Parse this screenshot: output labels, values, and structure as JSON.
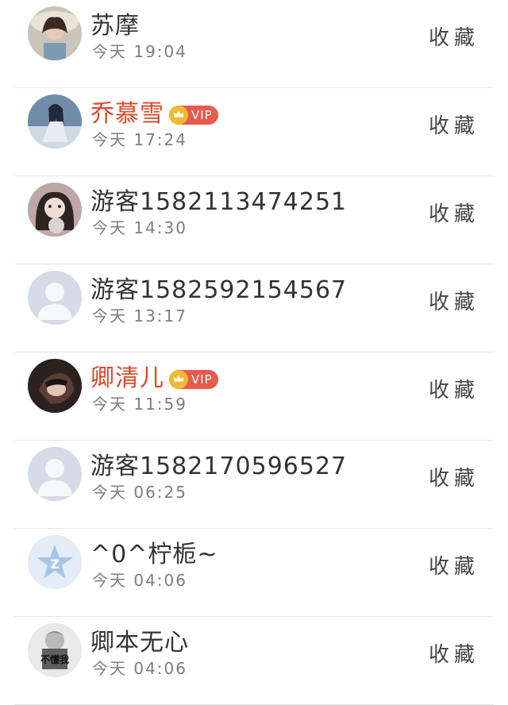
{
  "items": [
    {
      "name": "苏摩",
      "time": "今天 19:04",
      "fav": "收藏",
      "vip": false,
      "avatar": "photo-avatar"
    },
    {
      "name": "乔慕雪",
      "time": "今天 17:24",
      "fav": "收藏",
      "vip": true,
      "vip_label": "VIP",
      "avatar": "photo-avatar"
    },
    {
      "name": "游客1582113474251",
      "time": "今天 14:30",
      "fav": "收藏",
      "vip": false,
      "avatar": "photo-avatar"
    },
    {
      "name": "游客1582592154567",
      "time": "今天 13:17",
      "fav": "收藏",
      "vip": false,
      "avatar": "default-user-avatar"
    },
    {
      "name": "卿清儿",
      "time": "今天 11:59",
      "fav": "收藏",
      "vip": true,
      "vip_label": "VIP",
      "avatar": "photo-avatar"
    },
    {
      "name": "游客1582170596527",
      "time": "今天 06:25",
      "fav": "收藏",
      "vip": false,
      "avatar": "default-user-avatar"
    },
    {
      "name": "^0^柠栀~",
      "time": "今天 04:06",
      "fav": "收藏",
      "vip": false,
      "avatar": "qq-star-avatar"
    },
    {
      "name": "卿本无心",
      "time": "今天 04:06",
      "fav": "收藏",
      "vip": false,
      "avatar": "photo-avatar",
      "avatar_text": "不懂我"
    }
  ],
  "colors": {
    "vip_name": "#d84a2b",
    "vip_badge": "#e55b4d",
    "crown": "#f1b936",
    "default_avatar": "#d5dbe7"
  }
}
